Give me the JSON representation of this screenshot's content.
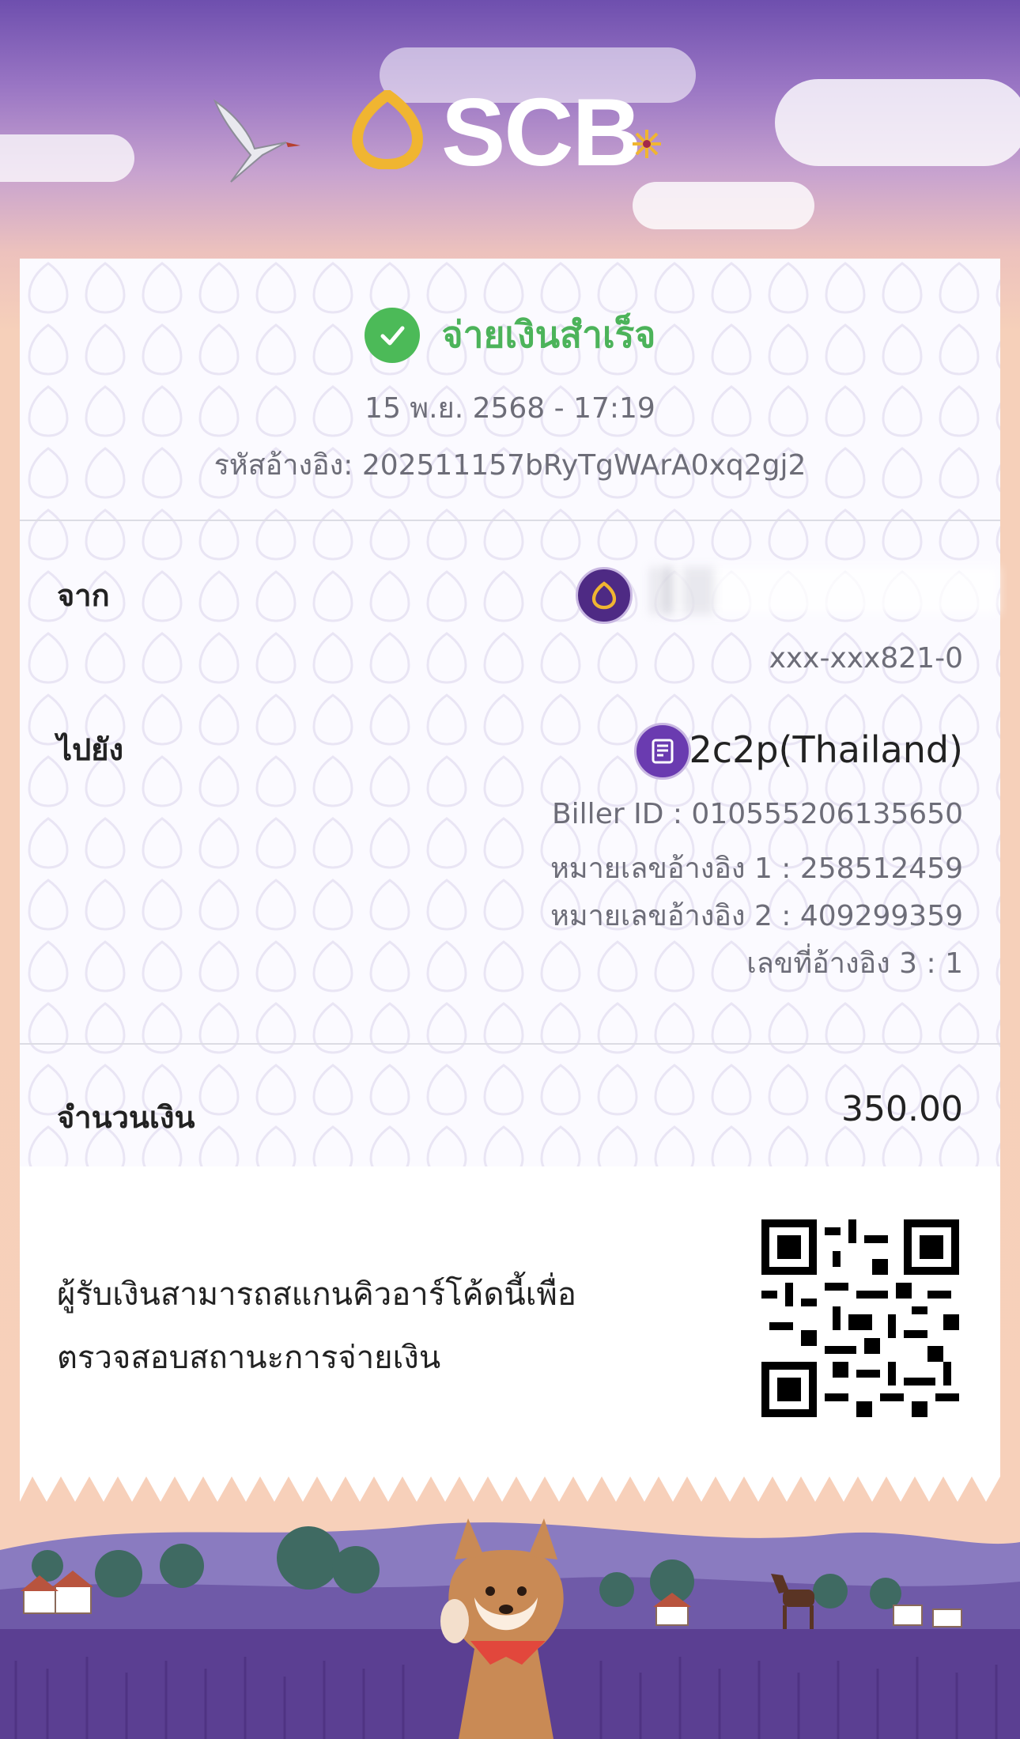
{
  "header": {
    "brand": "SCB"
  },
  "status": {
    "title": "จ่ายเงินสำเร็จ",
    "datetime": "15 พ.ย. 2568 - 17:19",
    "reference": "รหัสอ้างอิง: 202511157bRyTgWArA0xq2gj2"
  },
  "from": {
    "label": "จาก",
    "account": "xxx-xxx821-0"
  },
  "to": {
    "label": "ไปยัง",
    "name": "2c2p(Thailand)",
    "biller_id": "Biller ID : 010555206135650",
    "ref1": "หมายเลขอ้างอิง 1 : 258512459",
    "ref2": "หมายเลขอ้างอิง 2 : 409299359",
    "ref3": "เลขที่อ้างอิง 3 : 1"
  },
  "amount": {
    "label": "จำนวนเงิน",
    "value": "350.00"
  },
  "qr_note": {
    "line1": "ผู้รับเงินสามารถสแกนคิวอาร์โค้ดนี้เพื่อ",
    "line2": "ตรวจสอบสถานะการจ่ายเงิน"
  },
  "colors": {
    "accent": "#4cb35a",
    "brand": "#4e2a84",
    "gold": "#f0b531"
  },
  "icons": [
    "scb-logo-icon",
    "check-icon",
    "bank-avatar-icon",
    "biller-avatar-icon",
    "qr-code"
  ]
}
